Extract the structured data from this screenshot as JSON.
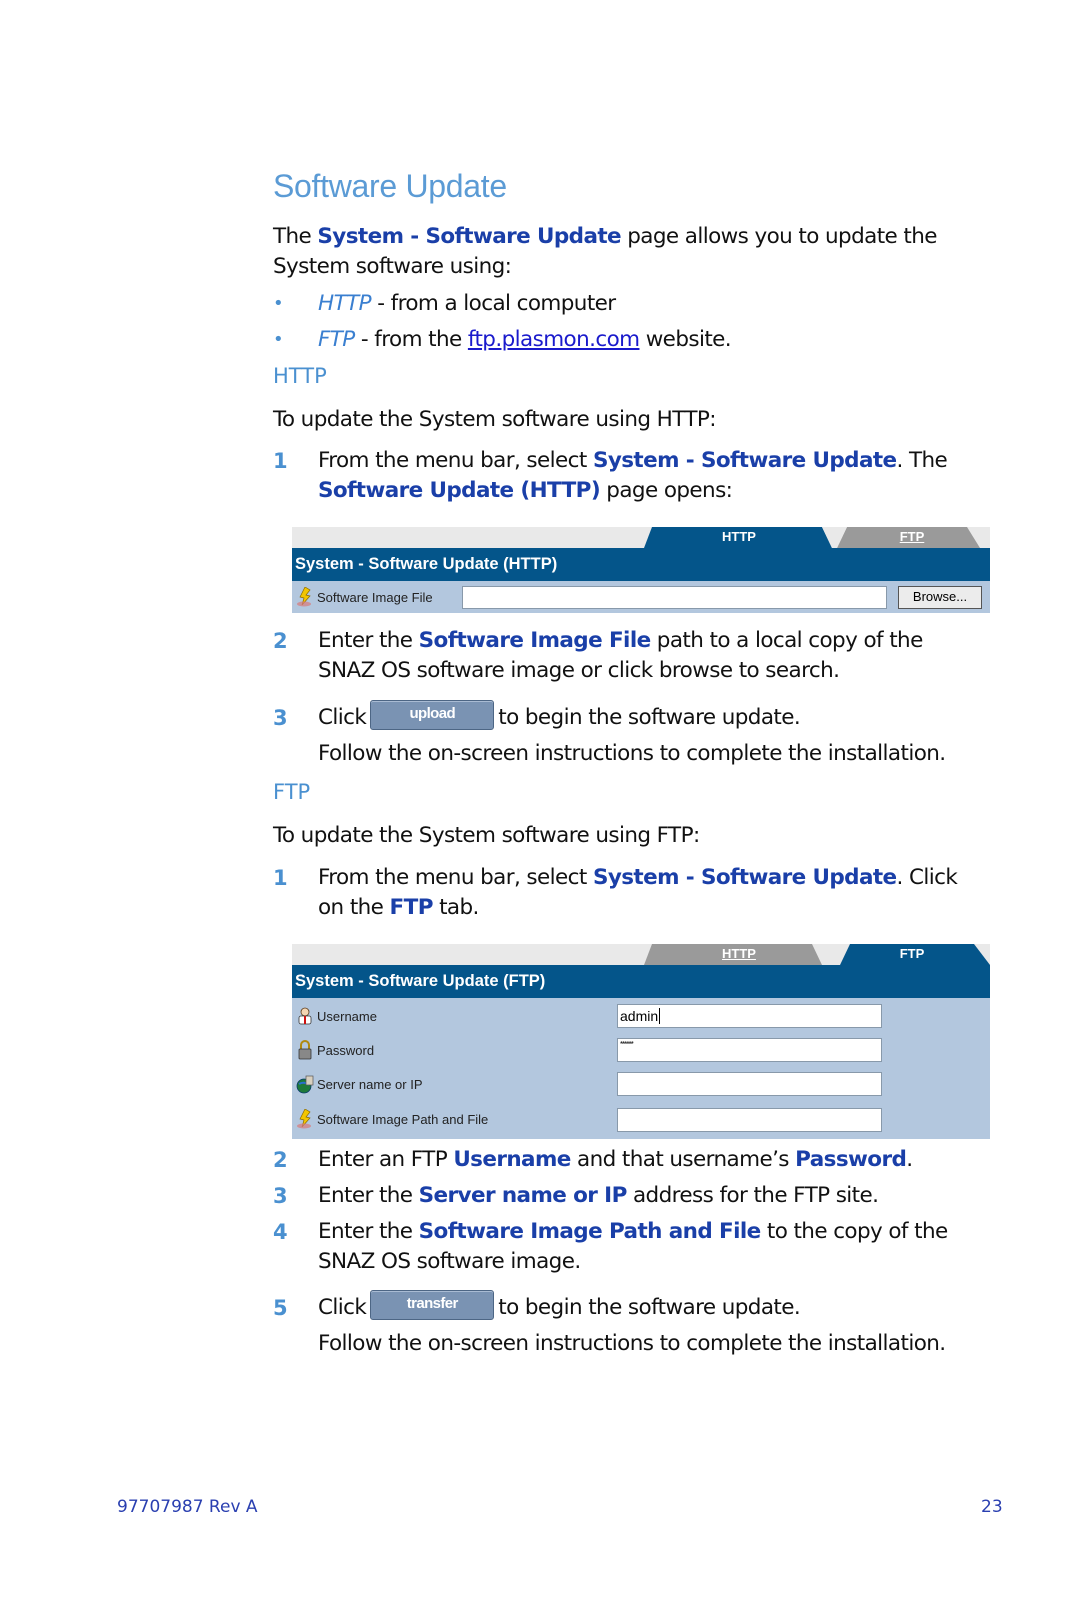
{
  "title": "Software Update",
  "intro": {
    "pre": "The ",
    "kw": "System - Software Update",
    "post1": " page allows you to update the",
    "line2": "System software using:"
  },
  "bullets": [
    {
      "italic": "HTTP",
      "text": " - from a local computer"
    },
    {
      "italic": "FTP",
      "text": " - from the ",
      "link": "ftp.plasmon.com",
      "after": " website."
    }
  ],
  "http_section": {
    "heading": "HTTP",
    "lead": "To update the System software using HTTP:",
    "steps": [
      {
        "num": "1",
        "pre": "From the menu bar, select ",
        "kw1": "System - Software Update",
        "mid": ". The",
        "kw2": "Software Update (HTTP)",
        "post": " page opens:"
      },
      {
        "num": "2",
        "pre": "Enter the ",
        "kw1": "Software Image File",
        "post": " path to a local copy of the",
        "line2": "SNAZ OS software image or click browse to search."
      },
      {
        "num": "3",
        "pre": "Click",
        "button": "upload",
        "post": "to begin the software update.",
        "line2": "Follow the on-screen instructions to complete the installation."
      }
    ],
    "panel": {
      "tabs": [
        {
          "label": "HTTP",
          "active": true
        },
        {
          "label": "FTP",
          "active": false
        }
      ],
      "header": "System - Software Update (HTTP)",
      "field_label": "Software Image File",
      "field_value": "",
      "browse_label": "Browse..."
    }
  },
  "ftp_section": {
    "heading": "FTP",
    "lead": "To update the System software using FTP:",
    "steps": [
      {
        "num": "1",
        "pre": "From the menu bar, select ",
        "kw1": "System - Software Update",
        "mid": ". Click",
        "line2_pre": "on the ",
        "kw2": "FTP",
        "post": " tab."
      },
      {
        "num": "2",
        "pre": "Enter an FTP ",
        "kw1": "Username",
        "mid": " and that username’s ",
        "kw2": "Password",
        "post": "."
      },
      {
        "num": "3",
        "pre": "Enter the ",
        "kw1": "Server name or IP",
        "post": " address for the FTP site."
      },
      {
        "num": "4",
        "pre": "Enter the ",
        "kw1": "Software Image Path and File",
        "post": " to the copy of the",
        "line2": "SNAZ OS software image."
      },
      {
        "num": "5",
        "pre": "Click",
        "button": "transfer",
        "post": "to begin the software update.",
        "line2": "Follow the on-screen instructions to complete the installation."
      }
    ],
    "panel": {
      "tabs": [
        {
          "label": "HTTP",
          "active": false
        },
        {
          "label": "FTP",
          "active": true
        }
      ],
      "header": "System - Software Update (FTP)",
      "fields": [
        {
          "label": "Username",
          "icon": "user-icon",
          "value": "admin"
        },
        {
          "label": "Password",
          "icon": "lock-icon",
          "value": "******"
        },
        {
          "label": "Server name or IP",
          "icon": "globe-server-icon",
          "value": ""
        },
        {
          "label": "Software Image Path and File",
          "icon": "software-image-icon",
          "value": ""
        }
      ]
    }
  },
  "footer": {
    "doc_id": "97707987 Rev A",
    "page_number": "23"
  },
  "colors": {
    "heading": "#5b9bd5",
    "keyword": "#1a3fa8",
    "panel_header": "#04558a",
    "panel_body": "#b3c7de",
    "tab_inactive": "#9a9a9a"
  }
}
